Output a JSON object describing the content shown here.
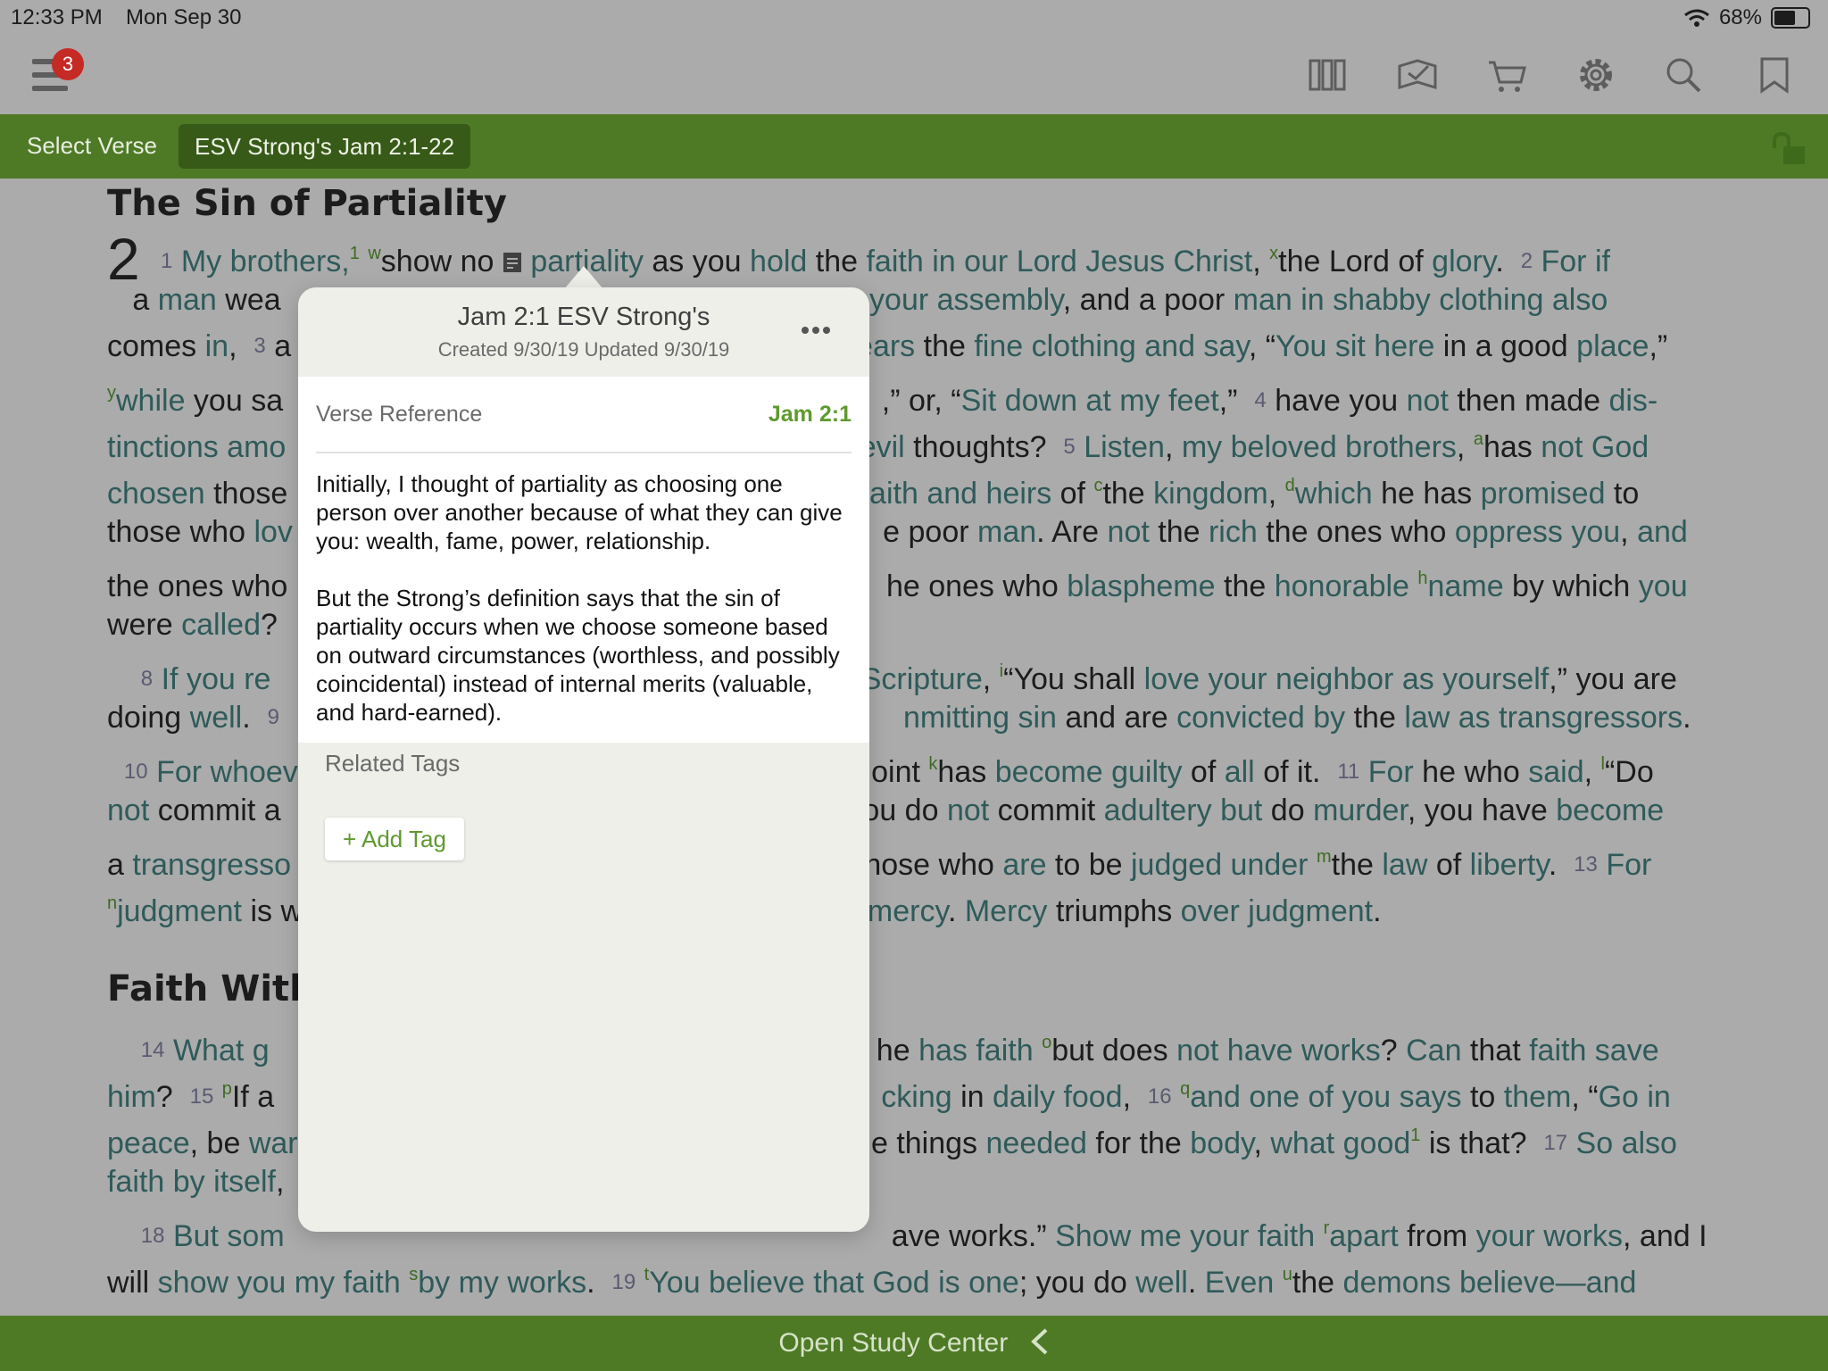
{
  "status": {
    "time": "12:33 PM",
    "date": "Mon Sep 30",
    "battery": "68%",
    "battery_level": 0.68
  },
  "toolbar": {
    "notifications": "3",
    "icons": [
      "library-icon",
      "reading-plan-icon",
      "cart-icon",
      "settings-icon",
      "search-icon",
      "bookmark-icon"
    ]
  },
  "nav": {
    "select_verse": "Select Verse",
    "active_tab": "ESV Strong's Jam 2:1-22"
  },
  "reader": {
    "heading1": "The Sin of Partiality",
    "chapter": "2",
    "heading2": "Faith Witho",
    "colors": {
      "link": "#2f5a5a",
      "footnote": "#3d6a22"
    }
  },
  "popover": {
    "title": "Jam 2:1 ESV Strong's",
    "subtitle": "Created 9/30/19 Updated 9/30/19",
    "ref_label": "Verse Reference",
    "ref_value": "Jam 2:1",
    "paragraph1": "Initially, I thought of partiality as choosing one person over another because of what they can give you: wealth, fame, power, relationship.",
    "paragraph2": "But the Strong’s definition says that the sin of partiality occurs when we choose someone based on outward circumstances (worthless, and possibly coincidental) instead of internal merits (valuable, and hard-earned).",
    "tags_label": "Related Tags",
    "add_tag": "+ Add Tag"
  },
  "bottom": {
    "label": "Open Study Center"
  }
}
